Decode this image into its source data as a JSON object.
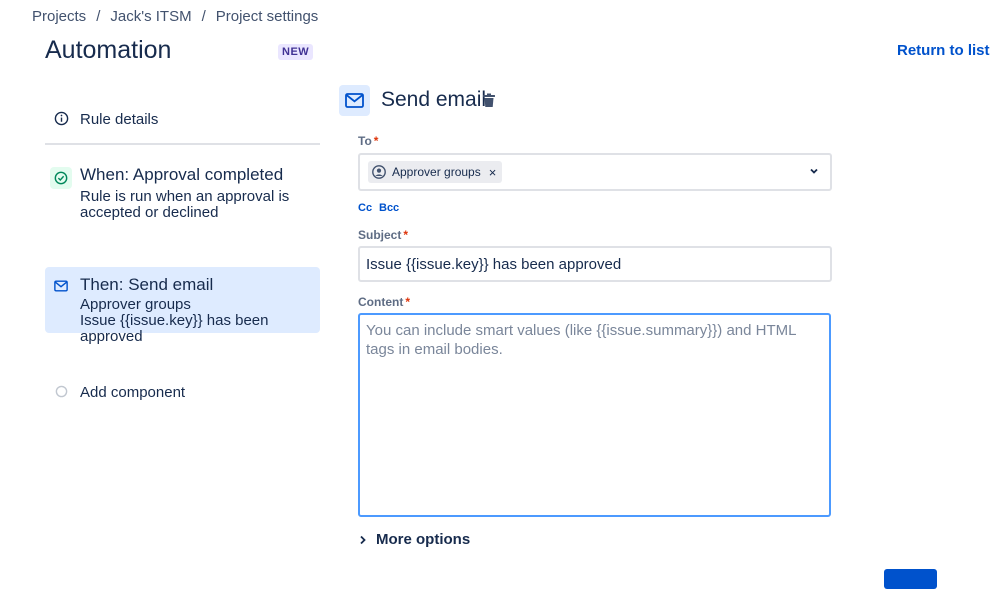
{
  "breadcrumb": {
    "items": [
      "Projects",
      "Jack's ITSM",
      "Project settings"
    ],
    "separator": "/"
  },
  "page": {
    "title": "Automation",
    "badge": "NEW",
    "return_link": "Return to list"
  },
  "left_panel": {
    "rule_details": "Rule details",
    "trigger": {
      "title": "When: Approval completed",
      "line1": "Rule is run when an approval is",
      "line2": "accepted or declined"
    },
    "action": {
      "title": "Then: Send email",
      "line1": "Approver groups",
      "line2": "Issue {{issue.key}} has been approved"
    },
    "add_component": "Add component"
  },
  "action_form": {
    "title": "Send email",
    "to": {
      "label": "To",
      "chip": "Approver groups"
    },
    "cc_label": "Cc",
    "bcc_label": "Bcc",
    "subject": {
      "label": "Subject",
      "value": "Issue {{issue.key}} has been approved"
    },
    "content": {
      "label": "Content",
      "placeholder": "You can include smart values (like {{issue.summary}}) and HTML tags in email bodies."
    },
    "more_options": "More options"
  },
  "required_marker": "*",
  "colors": {
    "accent": "#0052cc",
    "selected_step_bg": "#deebff",
    "trigger_icon_bg": "#e3fcef",
    "focus_border": "#4c9aff"
  }
}
